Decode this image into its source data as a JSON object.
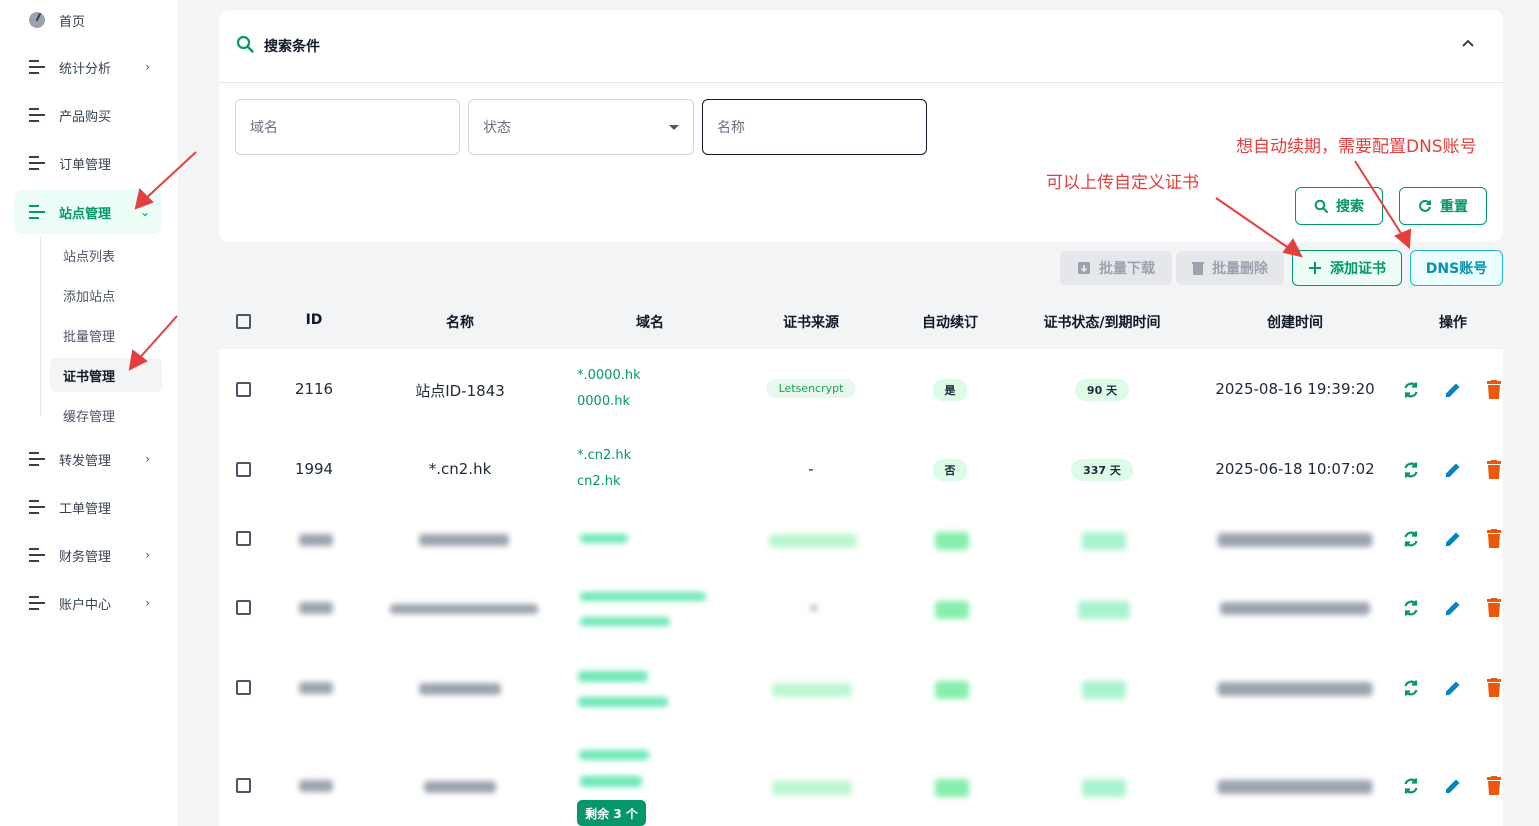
{
  "sidebar": {
    "items": [
      {
        "label": "首页",
        "icon": "gauge-icon"
      },
      {
        "label": "统计分析",
        "icon": "menu-icon",
        "arrow": "›"
      },
      {
        "label": "产品购买",
        "icon": "menu-icon"
      },
      {
        "label": "订单管理",
        "icon": "menu-icon"
      },
      {
        "label": "站点管理",
        "icon": "menu-icon",
        "arrow": "⌄"
      },
      {
        "label": "转发管理",
        "icon": "menu-icon",
        "arrow": "›"
      },
      {
        "label": "工单管理",
        "icon": "menu-icon"
      },
      {
        "label": "财务管理",
        "icon": "menu-icon",
        "arrow": "›"
      },
      {
        "label": "账户中心",
        "icon": "menu-icon",
        "arrow": "›"
      }
    ],
    "sub_items": [
      "站点列表",
      "添加站点",
      "批量管理",
      "证书管理",
      "缓存管理"
    ]
  },
  "search": {
    "title": "搜索条件",
    "domain_placeholder": "域名",
    "status_placeholder": "状态",
    "name_placeholder": "名称",
    "search_label": "搜索",
    "reset_label": "重置"
  },
  "toolbar": {
    "batch_download": "批量下载",
    "batch_delete": "批量删除",
    "add_cert": "添加证书",
    "dns_account": "DNS账号"
  },
  "annotations": {
    "upload_note": "可以上传自定义证书",
    "renew_note": "想自动续期，需要配置DNS账号"
  },
  "table": {
    "headers": [
      "ID",
      "名称",
      "域名",
      "证书来源",
      "自动续订",
      "证书状态/到期时间",
      "创建时间",
      "操作"
    ],
    "rows": [
      {
        "id": "2116",
        "name": "站点ID-1843",
        "domains": [
          "*.0000.hk",
          "0000.hk"
        ],
        "source": "Letsencrypt",
        "auto_renew": "是",
        "status": "90 天",
        "created": "2025-08-16 19:39:20"
      },
      {
        "id": "1994",
        "name": "*.cn2.hk",
        "domains": [
          "*.cn2.hk",
          "cn2.hk"
        ],
        "source": "-",
        "auto_renew": "否",
        "status": "337 天",
        "created": "2025-06-18 10:07:02"
      }
    ],
    "remaining_badge": "剩余 3 个"
  },
  "colors": {
    "accent": "#059669",
    "annotation": "#e53e3e",
    "delete": "#ea580c",
    "edit": "#0284c7",
    "cyan": "#0891b2"
  }
}
